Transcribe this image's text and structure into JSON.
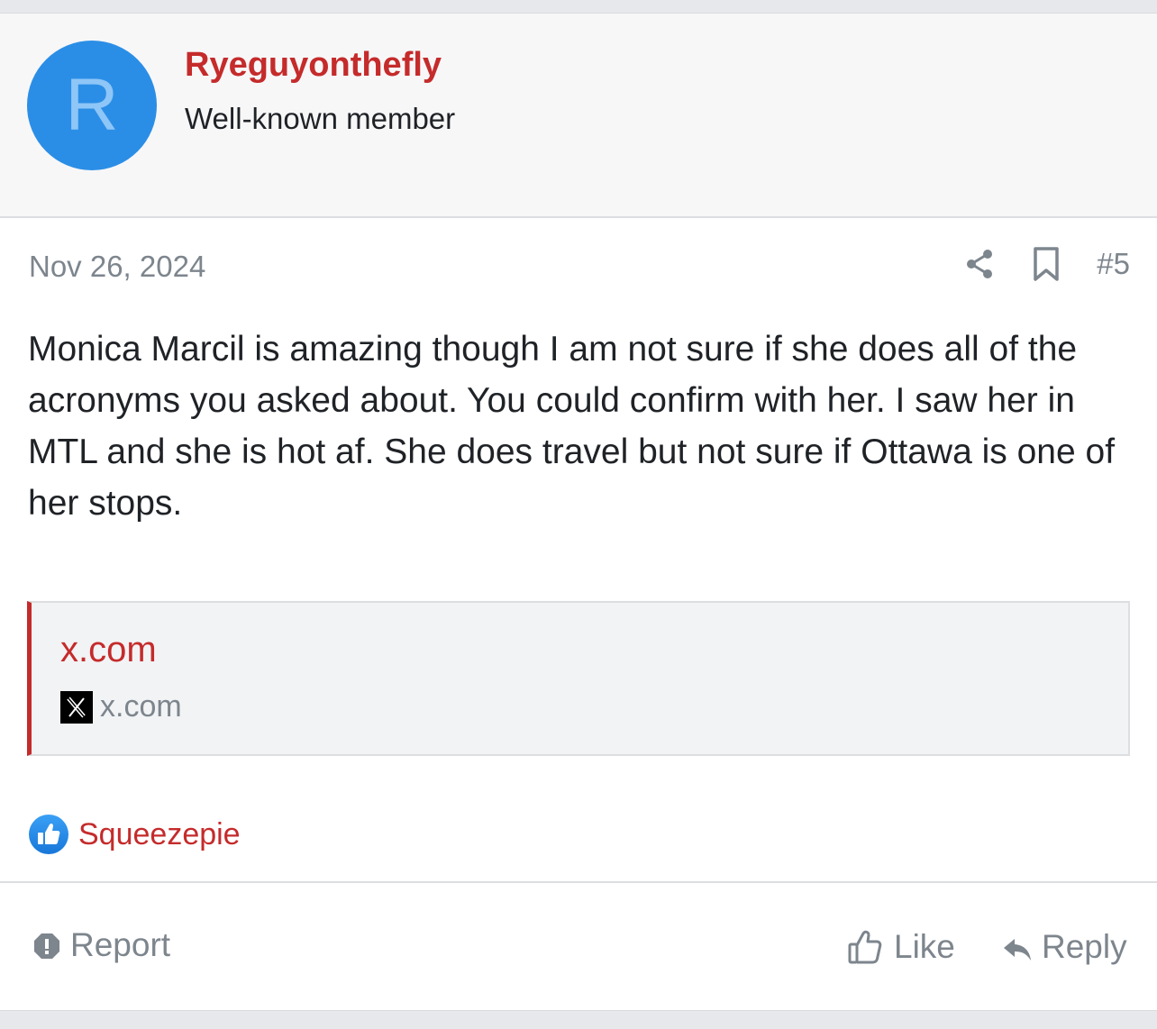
{
  "user": {
    "avatar_letter": "R",
    "name": "Ryeguyonthefly",
    "title": "Well-known member"
  },
  "post": {
    "date": "Nov 26, 2024",
    "number": "#5",
    "body": "Monica Marcil is amazing though I am not sure if she does all of the acronyms you asked about. You could confirm with her. I saw her in MTL and she is hot af. She does travel but not sure if Ottawa is one of her stops."
  },
  "embed": {
    "title": "x.com",
    "domain": "x.com",
    "icon": "x-logo-icon"
  },
  "reactions": {
    "icon": "thumbs-up-icon",
    "users": "Squeezepie"
  },
  "actions": {
    "report": "Report",
    "like": "Like",
    "reply": "Reply"
  },
  "colors": {
    "accent": "#c52b2b",
    "avatar_bg": "#2b8ee6",
    "muted": "#7d858d",
    "text": "#1f2226"
  }
}
